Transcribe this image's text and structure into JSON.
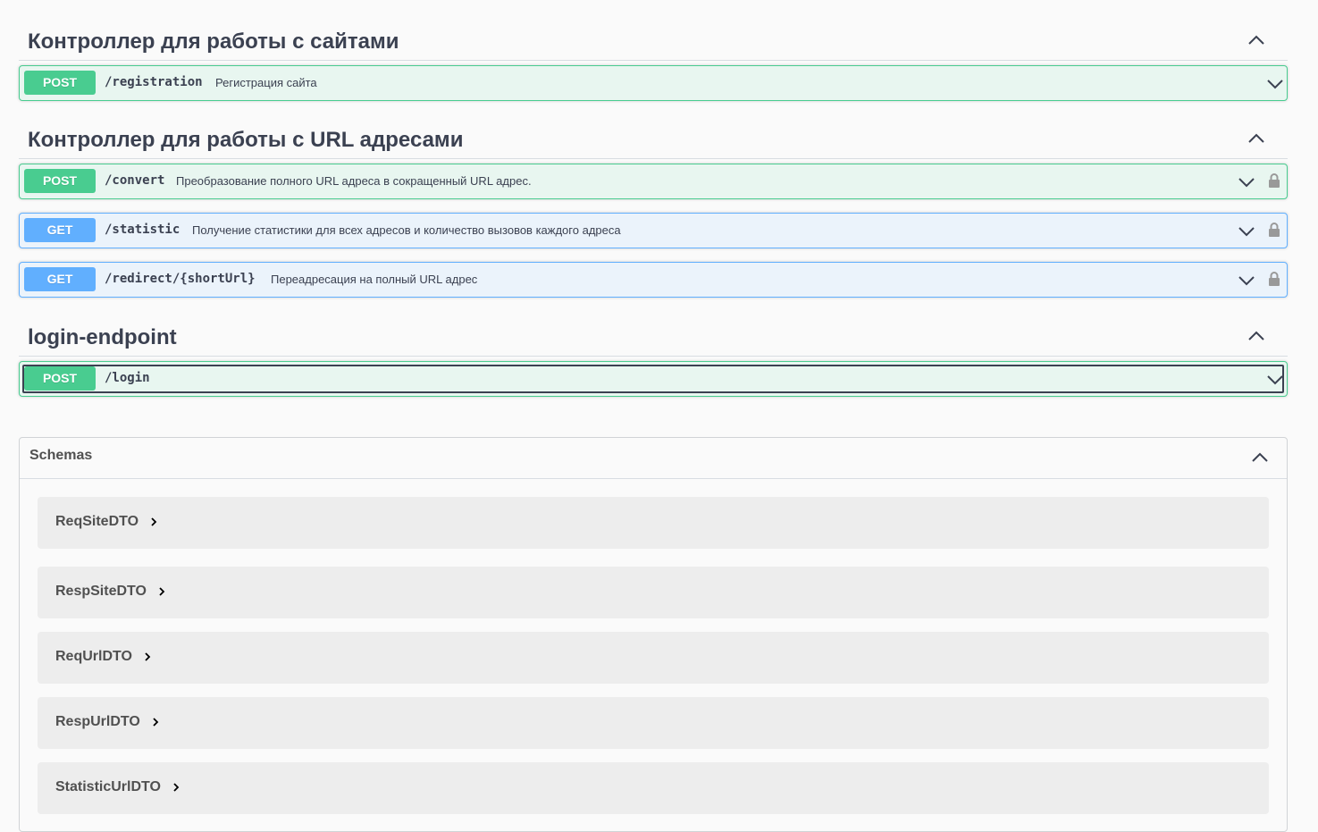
{
  "tags": [
    {
      "title": "Контроллер для работы с сайтами",
      "operations": [
        {
          "method": "POST",
          "path": "/registration",
          "summary": "Регистрация сайта",
          "locked": false
        }
      ]
    },
    {
      "title": "Контроллер для работы с URL адресами",
      "operations": [
        {
          "method": "POST",
          "path": "/convert",
          "summary": "Преобразование полного URL адреса в сокращенный URL адрес.",
          "locked": true
        },
        {
          "method": "GET",
          "path": "/statistic",
          "summary": "Получение статистики для всех адресов и количество вызовов каждого адреса",
          "locked": true
        },
        {
          "method": "GET",
          "path": "/redirect/{shortUrl}",
          "summary": "Переадресация на полный URL адрес",
          "locked": true
        }
      ]
    },
    {
      "title": "login-endpoint",
      "operations": [
        {
          "method": "POST",
          "path": "/login",
          "summary": "",
          "locked": false
        }
      ]
    }
  ],
  "schemas": {
    "title": "Schemas",
    "models": [
      "ReqSiteDTO",
      "RespSiteDTO",
      "ReqUrlDTO",
      "RespUrlDTO",
      "StatisticUrlDTO"
    ]
  },
  "colors": {
    "post": "#49cc90",
    "post_bg": "#e8f6f0",
    "get": "#61affe",
    "get_bg": "#ebf3fb",
    "text": "#3b4151"
  },
  "icons": {
    "tag_toggle": "chevron-up-icon",
    "op_toggle": "chevron-down-icon",
    "auth": "lock-icon",
    "model_expand": "chevron-right-icon"
  }
}
